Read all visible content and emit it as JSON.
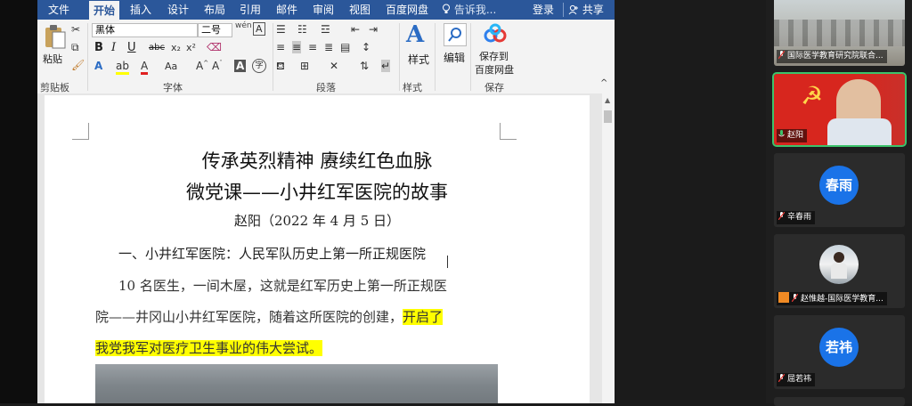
{
  "menubar": {
    "tabs": [
      "文件",
      "开始",
      "插入",
      "设计",
      "布局",
      "引用",
      "邮件",
      "审阅",
      "视图",
      "百度网盘"
    ],
    "active_tab": "开始",
    "tell_me": "告诉我...",
    "login": "登录",
    "share": "共享"
  },
  "ribbon": {
    "paste_label": "粘贴",
    "font_name": "黑体",
    "font_size": "二号",
    "bold": "B",
    "italic": "I",
    "underline": "U",
    "strike": "abc",
    "styles_label": "样式",
    "edit_label": "编辑",
    "save_baidu_line1": "保存到",
    "save_baidu_line2": "百度网盘",
    "group_clipboard": "剪贴板",
    "group_font": "字体",
    "group_paragraph": "段落",
    "group_styles": "样式",
    "group_save": "保存"
  },
  "document": {
    "title1": "传承英烈精神 赓续红色血脉",
    "title2": "微党课——小井红军医院的故事",
    "author": "赵阳（2022 年 4 月 5 日）",
    "heading1": "一、小井红军医院：人民军队历史上第一所正规医院",
    "para_line1": "10 名医生，一间木屋，这就是红军历史上第一所正规医",
    "para_line2_plain": "院——井冈山小井红军医院，随着这所医院的创建，",
    "para_line2_hl": "开启了",
    "para_line3_hl": "我党我军对医疗卫生事业的伟大尝试。"
  },
  "participants": [
    {
      "name": "国际医学教育研究院联合...",
      "kind": "video"
    },
    {
      "name": "赵阳",
      "kind": "video",
      "active": true
    },
    {
      "name": "辛春雨",
      "kind": "avatar",
      "avatar_text": "春雨",
      "color": "#1a73e8"
    },
    {
      "name": "赵惟越-国际医学教育...",
      "kind": "photo"
    },
    {
      "name": "屈若祎",
      "kind": "avatar",
      "avatar_text": "若祎",
      "color": "#1a73e8"
    }
  ]
}
